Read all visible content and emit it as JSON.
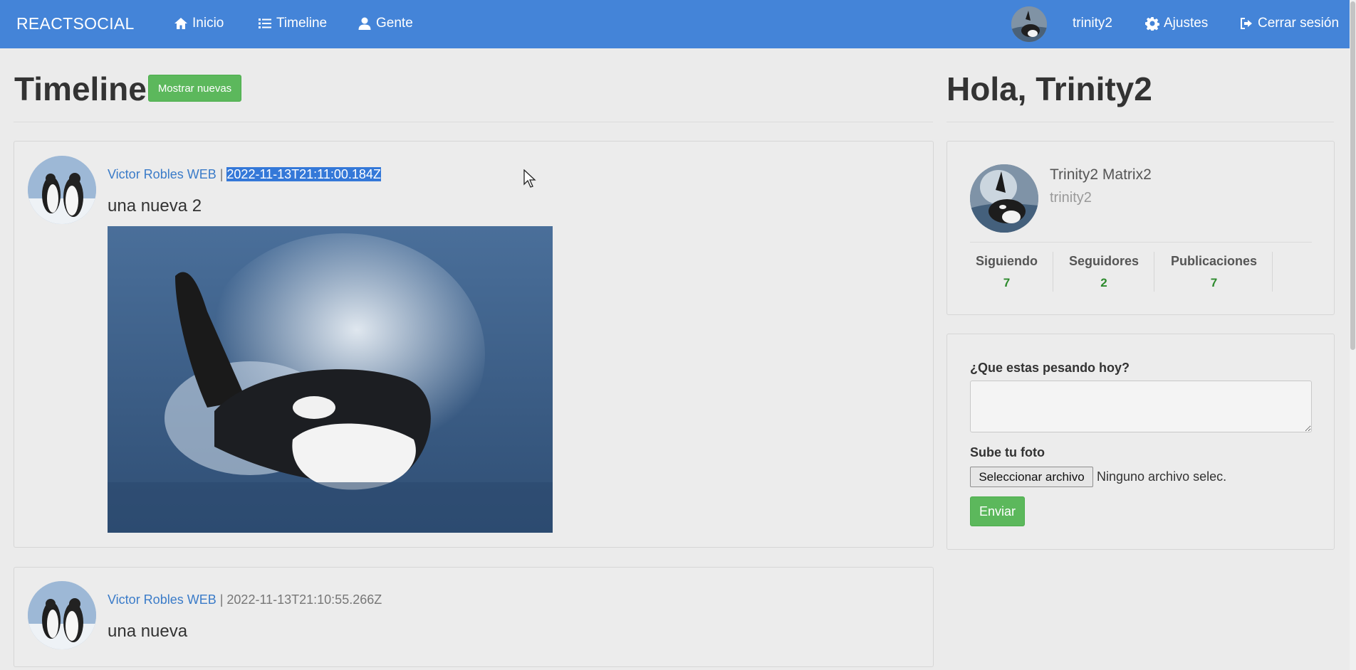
{
  "navbar": {
    "brand": "REACTSOCIAL",
    "items": [
      {
        "label": "Inicio",
        "icon": "home-icon"
      },
      {
        "label": "Timeline",
        "icon": "list-icon"
      },
      {
        "label": "Gente",
        "icon": "user-icon"
      }
    ],
    "username": "trinity2",
    "settings_label": "Ajustes",
    "logout_label": "Cerrar sesión",
    "background_color": "#4484d8"
  },
  "timeline": {
    "title": "Timeline",
    "show_new_label": "Mostrar nuevas",
    "separator": " | ",
    "posts": [
      {
        "user": "Victor Robles WEB",
        "date": "2022-11-13T21:11:00.184Z",
        "text": "una nueva 2",
        "has_image": true,
        "date_selected": true
      },
      {
        "user": "Victor Robles WEB",
        "date": "2022-11-13T21:10:55.266Z",
        "text": "una nueva",
        "has_image": false,
        "date_selected": false
      }
    ]
  },
  "sidebar": {
    "greeting": "Hola, Trinity2",
    "profile": {
      "name": "Trinity2 Matrix2",
      "nick": "trinity2",
      "stats": [
        {
          "label": "Siguiendo",
          "value": "7"
        },
        {
          "label": "Seguidores",
          "value": "2"
        },
        {
          "label": "Publicaciones",
          "value": "7"
        }
      ]
    },
    "form": {
      "question_label": "¿Que estas pesando hoy?",
      "textarea_value": "",
      "photo_label": "Sube tu foto",
      "file_button_label": "Seleccionar archivo",
      "file_status": "Ninguno archivo selec.",
      "submit_label": "Enviar"
    }
  },
  "colors": {
    "accent_green": "#5cb85c",
    "link_blue": "#3a7bc8",
    "stat_green": "#2d8a2d"
  }
}
